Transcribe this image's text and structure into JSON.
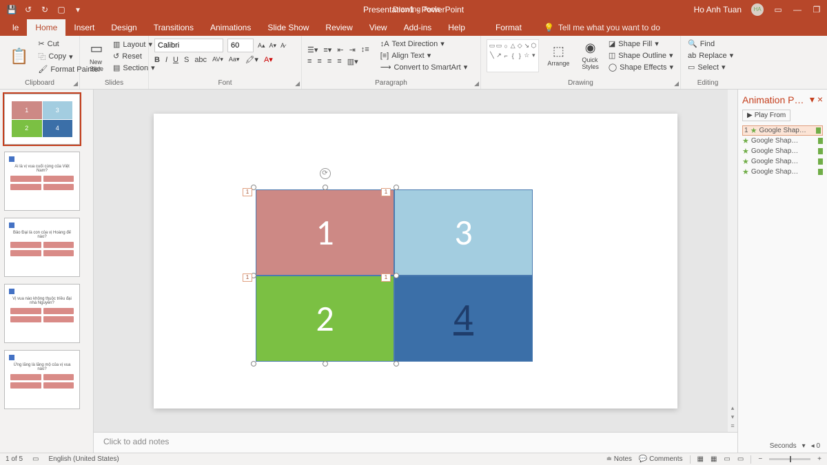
{
  "title": "Presentation1 - PowerPoint",
  "toolContext": "Drawing Tools",
  "user": {
    "name": "Ho Anh Tuan",
    "initials": "HA"
  },
  "tabs": [
    "le",
    "Home",
    "Insert",
    "Design",
    "Transitions",
    "Animations",
    "Slide Show",
    "Review",
    "View",
    "Add-ins",
    "Help",
    "Format"
  ],
  "tellme": "Tell me what you want to do",
  "clipboard": {
    "cut": "Cut",
    "copy": "Copy",
    "fp": "Format Painter",
    "label": "Clipboard"
  },
  "slides": {
    "new": "New\nSlide",
    "layout": "Layout",
    "reset": "Reset",
    "section": "Section",
    "label": "Slides"
  },
  "font": {
    "name": "Calibri",
    "size": "60",
    "label": "Font"
  },
  "paragraph": {
    "td": "Text Direction",
    "align": "Align Text",
    "smart": "Convert to SmartArt",
    "label": "Paragraph"
  },
  "drawing": {
    "arrange": "Arrange",
    "qs": "Quick\nStyles",
    "fill": "Shape Fill",
    "outline": "Shape Outline",
    "effects": "Shape Effects",
    "label": "Drawing"
  },
  "editing": {
    "find": "Find",
    "replace": "Replace",
    "select": "Select",
    "label": "Editing"
  },
  "slide": {
    "q1": "1",
    "q2": "2",
    "q3": "3",
    "q4": "4"
  },
  "thumbTexts": {
    "t2": "Ai là vị vua cuối cùng của Việt Nam?",
    "t3": "Bảo Đại là con của vị Hoàng đế nào?",
    "t4": "Vị vua nào không thuộc triều đại nhà Nguyễn?",
    "t5": "Ứng lăng là lăng mộ của vị vua nào?"
  },
  "notes": "Click to add notes",
  "animPane": {
    "title": "Animation P…",
    "play": "Play From",
    "item": "Google Shap…",
    "num": "1"
  },
  "seconds": "Seconds",
  "status": {
    "slide": "1 of 5",
    "lang": "English (United States)",
    "notes": "Notes",
    "comments": "Comments"
  }
}
